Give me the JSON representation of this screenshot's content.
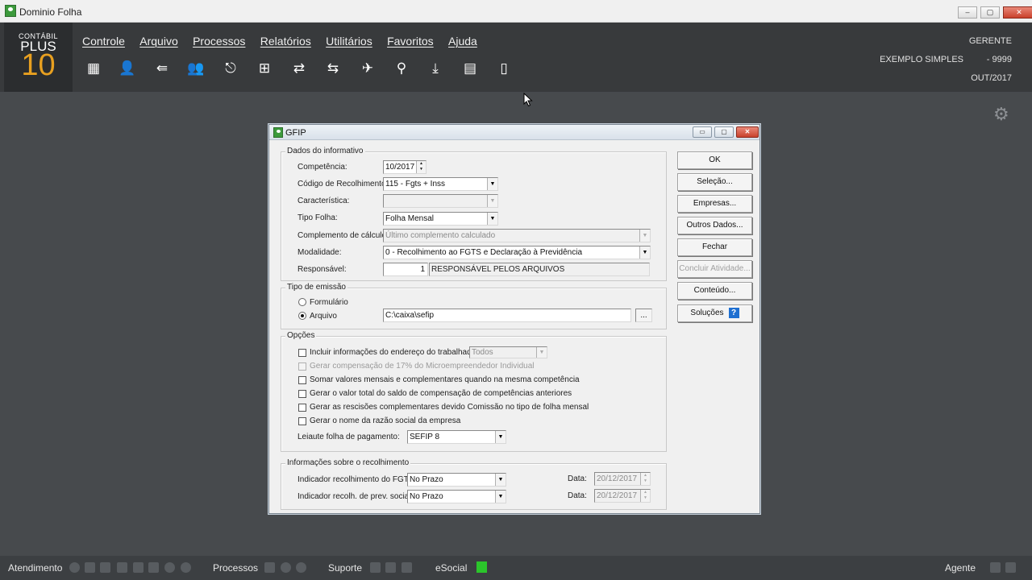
{
  "window": {
    "title": "Dominio Folha",
    "controls": [
      "‒",
      "▢",
      "✕"
    ]
  },
  "logo": {
    "line1": "CONTÁBIL",
    "line2": "PLUS",
    "line3": "10"
  },
  "menu": [
    "Controle",
    "Arquivo",
    "Processos",
    "Relatórios",
    "Utilitários",
    "Favoritos",
    "Ajuda"
  ],
  "toolbar": [
    {
      "icon": "building-icon",
      "glyph": "▦"
    },
    {
      "icon": "person-icon",
      "glyph": "👤"
    },
    {
      "icon": "login-arrow-icon",
      "glyph": "⇚"
    },
    {
      "icon": "person-search-icon",
      "glyph": "👥"
    },
    {
      "icon": "exit-door-icon",
      "glyph": "⎋"
    },
    {
      "icon": "calculator-sheet-icon",
      "glyph": "⊞"
    },
    {
      "icon": "transfer-arrows-icon",
      "glyph": "⇄"
    },
    {
      "icon": "document-exchange-icon",
      "glyph": "⇆"
    },
    {
      "icon": "airplane-icon",
      "glyph": "✈"
    },
    {
      "icon": "magnifier-icon",
      "glyph": "⚲"
    },
    {
      "icon": "download-icon",
      "glyph": "⤓"
    },
    {
      "icon": "calculator-icon",
      "glyph": "▤"
    },
    {
      "icon": "book-icon",
      "glyph": "▯"
    }
  ],
  "header_info": {
    "user": "GERENTE",
    "company": "EXEMPLO SIMPLES",
    "company_code": "- 9999",
    "period": "OUT/2017"
  },
  "dialog": {
    "title": "GFIP",
    "controls": [
      "▭",
      "▢",
      "✕"
    ],
    "dados": {
      "group": "Dados do informativo",
      "competencia_label": "Competência:",
      "competencia": "10/2017",
      "codigo_label": "Código de Recolhimento:",
      "codigo": "115 - Fgts + Inss",
      "caracteristica_label": "Característica:",
      "caracteristica": "",
      "tipo_folha_label": "Tipo Folha:",
      "tipo_folha": "Folha Mensal",
      "complemento_label": "Complemento de cálculo:",
      "complemento": "Último complemento calculado",
      "modalidade_label": "Modalidade:",
      "modalidade": "0 - Recolhimento ao FGTS e Declaração à Previdência",
      "responsavel_label": "Responsável:",
      "responsavel_num": "1",
      "responsavel_nome": "RESPONSÁVEL PELOS ARQUIVOS"
    },
    "emissao": {
      "group": "Tipo de emissão",
      "formulario": "Formulário",
      "arquivo": "Arquivo",
      "arquivo_path": "C:\\caixa\\sefip",
      "browse": "..."
    },
    "opcoes": {
      "group": "Opções",
      "items": [
        {
          "label": "Incluir informações do endereço do trabalhador",
          "enabled": true,
          "checked": false
        },
        {
          "label": "Gerar compensação de 17% do Microempreendedor Individual",
          "enabled": false,
          "checked": false
        },
        {
          "label": "Somar valores mensais e complementares quando na mesma competência",
          "enabled": true,
          "checked": false
        },
        {
          "label": "Gerar o valor total do saldo de compensação de competências anteriores",
          "enabled": true,
          "checked": false
        },
        {
          "label": "Gerar as rescisões complementares devido Comissão no tipo de folha mensal",
          "enabled": true,
          "checked": false
        },
        {
          "label": "Gerar o nome da razão social da empresa",
          "enabled": true,
          "checked": false
        }
      ],
      "endereco_select": "Todos",
      "leiaute_label": "Leiaute folha de pagamento:",
      "leiaute": "SEFIP 8"
    },
    "recolhimento": {
      "group": "Informações sobre o recolhimento",
      "fgts_label": "Indicador recolhimento do FGTS:",
      "fgts": "No Prazo",
      "prev_label": "Indicador recolh. de prev. social:",
      "prev": "No Prazo",
      "data_label": "Data:",
      "data_fgts": "20/12/2017",
      "data_prev": "20/12/2017"
    },
    "buttons": {
      "ok": "OK",
      "selecao": "Seleção...",
      "empresas": "Empresas...",
      "outros": "Outros Dados...",
      "fechar": "Fechar",
      "concluir": "Concluir Atividade...",
      "conteudo": "Conteúdo...",
      "solucoes": "Soluções",
      "help": "?"
    }
  },
  "statusbar": {
    "atendimento": "Atendimento",
    "processos": "Processos",
    "suporte": "Suporte",
    "esocial": "eSocial",
    "agente": "Agente"
  },
  "colors": {
    "accent": "#e8a020",
    "header": "#383a3c",
    "background": "#474a4d",
    "esocial_indicator": "#2bc52b"
  }
}
